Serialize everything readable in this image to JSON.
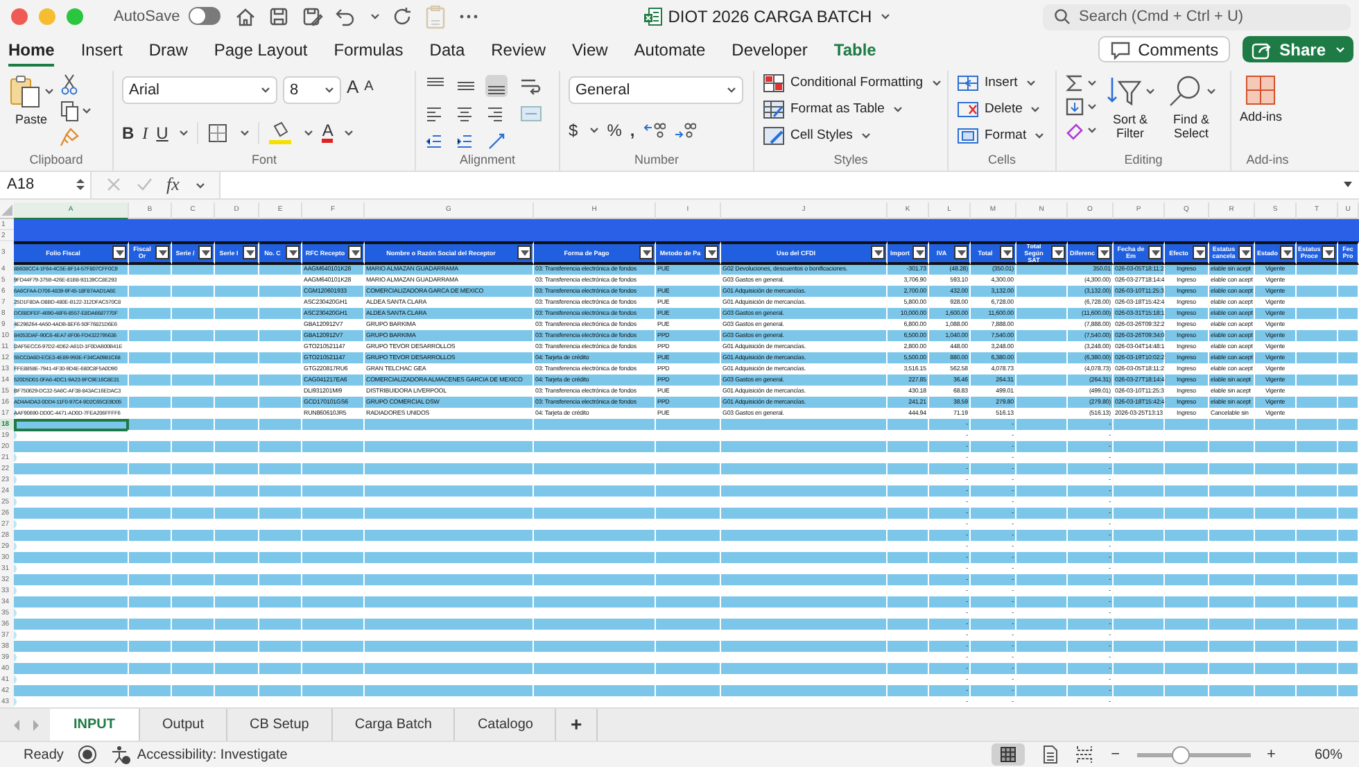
{
  "window": {
    "title": "DIOT 2026 CARGA BATCH",
    "autosave": {
      "label": "AutoSave",
      "on": false
    }
  },
  "search": {
    "placeholder": "Search (Cmd + Ctrl + U)"
  },
  "ribbon_tabs": [
    {
      "label": "Home",
      "selected": true,
      "kind": "standard"
    },
    {
      "label": "Insert",
      "selected": false,
      "kind": "standard"
    },
    {
      "label": "Draw",
      "selected": false,
      "kind": "standard"
    },
    {
      "label": "Page Layout",
      "selected": false,
      "kind": "standard"
    },
    {
      "label": "Formulas",
      "selected": false,
      "kind": "standard"
    },
    {
      "label": "Data",
      "selected": false,
      "kind": "standard"
    },
    {
      "label": "Review",
      "selected": false,
      "kind": "standard"
    },
    {
      "label": "View",
      "selected": false,
      "kind": "standard"
    },
    {
      "label": "Automate",
      "selected": false,
      "kind": "standard"
    },
    {
      "label": "Developer",
      "selected": false,
      "kind": "standard"
    },
    {
      "label": "Table",
      "selected": false,
      "kind": "contextual"
    }
  ],
  "comments_button": "Comments",
  "share_button": "Share",
  "ribbon": {
    "clipboard": {
      "label": "Clipboard",
      "paste": "Paste"
    },
    "font": {
      "label": "Font",
      "name": "Arial",
      "size": "8",
      "grow": "A",
      "shrink": "A",
      "bold": "B",
      "italic": "I",
      "underline": "U",
      "color_button": "A"
    },
    "alignment": {
      "label": "Alignment",
      "vertical": [
        {
          "selected": false
        },
        {
          "selected": false
        },
        {
          "selected": true
        }
      ]
    },
    "number": {
      "label": "Number",
      "format": "General",
      "currency": "$",
      "percent": "%",
      "comma": ","
    },
    "styles": {
      "label": "Styles",
      "items": [
        "Conditional Formatting",
        "Format as Table",
        "Cell Styles"
      ]
    },
    "cells": {
      "label": "Cells",
      "items": [
        "Insert",
        "Delete",
        "Format"
      ]
    },
    "editing": {
      "label": "Editing",
      "sort": "Sort & Filter",
      "find": "Find & Select"
    },
    "addins": {
      "label": "Add-ins",
      "button": "Add-ins"
    }
  },
  "formula_bar": {
    "cell": "A18",
    "fx": "fx"
  },
  "grid": {
    "band_rows": [
      "1",
      "2"
    ],
    "header_row": "3",
    "columns": [
      {
        "letter": "A",
        "header": "Folio Fiscal",
        "kind": "id",
        "filter": true,
        "selected": true
      },
      {
        "letter": "B",
        "header": "Fiscal Or",
        "kind": "text",
        "filter": true,
        "selected": false
      },
      {
        "letter": "C",
        "header": "Serie /",
        "kind": "text",
        "filter": true,
        "selected": false
      },
      {
        "letter": "D",
        "header": "Serie I",
        "kind": "text",
        "filter": true,
        "selected": false
      },
      {
        "letter": "E",
        "header": "No. C",
        "kind": "text",
        "filter": true,
        "selected": false
      },
      {
        "letter": "F",
        "header": "RFC Recepto",
        "kind": "text",
        "filter": true,
        "selected": false
      },
      {
        "letter": "G",
        "header": "Nombre o Razón Social del Receptor",
        "kind": "text",
        "filter": true,
        "selected": false
      },
      {
        "letter": "H",
        "header": "Forma de Pago",
        "kind": "text",
        "filter": true,
        "selected": false
      },
      {
        "letter": "I",
        "header": "Metodo de Pa",
        "kind": "text",
        "filter": true,
        "selected": false
      },
      {
        "letter": "J",
        "header": "Uso del CFDI",
        "kind": "text",
        "filter": true,
        "selected": false
      },
      {
        "letter": "K",
        "header": "Import",
        "kind": "amount",
        "filter": true,
        "selected": false
      },
      {
        "letter": "L",
        "header": "IVA",
        "kind": "amount",
        "filter": true,
        "selected": false
      },
      {
        "letter": "M",
        "header": "Total",
        "kind": "amount",
        "filter": true,
        "selected": false
      },
      {
        "letter": "N",
        "header": "Total Según SAT",
        "kind": "amount",
        "filter": true,
        "selected": false
      },
      {
        "letter": "O",
        "header": "Diferenc",
        "kind": "amount",
        "filter": true,
        "selected": false
      },
      {
        "letter": "P",
        "header": "Fecha de Em",
        "kind": "text",
        "filter": true,
        "selected": false
      },
      {
        "letter": "Q",
        "header": "Efecto",
        "kind": "center",
        "filter": true,
        "selected": false
      },
      {
        "letter": "R",
        "header": "Estatus cancela",
        "kind": "text",
        "filter": true,
        "selected": false
      },
      {
        "letter": "S",
        "header": "Estado",
        "kind": "center",
        "filter": true,
        "selected": false
      },
      {
        "letter": "T",
        "header": "Estatus Proce",
        "kind": "text",
        "filter": true,
        "selected": false
      },
      {
        "letter": "U",
        "header": "Fec Pro",
        "kind": "text",
        "filter": false,
        "selected": false
      }
    ],
    "rows": [
      {
        "number": "4",
        "selected": false,
        "cells": {
          "A": "88608CC4-1F64-4C5E-8F14-57F807CFF0C9",
          "F": "AAGM640101K28",
          "G": "MARIO ALMAZAN GUADARRAMA",
          "H": "03: Transferencia electrónica de fondos",
          "I": "PUE",
          "J": "G02 Devoluciones, descuentos o bonificaciones.",
          "K": "-301.73",
          "L": "(48.28)",
          "M": "(350.01)",
          "O": "350.01",
          "P": "026-03-05T18:11:2",
          "Q": "Ingreso",
          "R": "elable sin acept",
          "S": "Vigente"
        }
      },
      {
        "number": "5",
        "selected": false,
        "cells": {
          "A": "9FD44F79-375B-426E-81B8-93139CC8E293",
          "F": "AAGM640101K28",
          "G": "MARIO ALMAZAN GUADARRAMA",
          "H": "03: Transferencia electrónica de fondos",
          "J": "G03 Gastos en general.",
          "K": "3,706.90",
          "L": "593.10",
          "M": "4,300.00",
          "O": "(4,300.00)",
          "P": "026-03-27T18:14:4",
          "Q": "Ingreso",
          "R": "elable con acept",
          "S": "Vigente"
        }
      },
      {
        "number": "6",
        "selected": false,
        "cells": {
          "A": "6A6CFAA-D706-4839-9F45-18F87AAD1A6E",
          "F": "CGM120601933",
          "G": "COMERCIALIZADORA GARCA DE MEXICO",
          "H": "03: Transferencia electrónica de fondos",
          "I": "PUE",
          "J": "G01 Adquisición de mercancías.",
          "K": "2,700.00",
          "L": "432.00",
          "M": "3,132.00",
          "O": "(3,132.00)",
          "P": "026-03-10T11:25:3",
          "Q": "Ingreso",
          "R": "elable con acept",
          "S": "Vigente"
        }
      },
      {
        "number": "7",
        "selected": false,
        "cells": {
          "A": "25D1F8DA-D8BD-480E-B122-312DFAC570C8",
          "F": "ASC230420GH1",
          "G": "ALDEA SANTA CLARA",
          "H": "03: Transferencia electrónica de fondos",
          "I": "PUE",
          "J": "G01 Adquisición de mercancías.",
          "K": "5,800.00",
          "L": "928.00",
          "M": "6,728.00",
          "O": "(6,728.00)",
          "P": "026-03-18T15:42:4",
          "Q": "Ingreso",
          "R": "elable con acept",
          "S": "Vigente"
        }
      },
      {
        "number": "8",
        "selected": false,
        "cells": {
          "A": "DC68DFEF-4690-48F6-8557-E8DA6687770F",
          "F": "ASC230420GH1",
          "G": "ALDEA SANTA CLARA",
          "H": "03: Transferencia electrónica de fondos",
          "I": "PUE",
          "J": "G03 Gastos en general.",
          "K": "10,000.00",
          "L": "1,600.00",
          "M": "11,600.00",
          "O": "(11,600.00)",
          "P": "026-03-31T15:18:1",
          "Q": "Ingreso",
          "R": "elable con acept",
          "S": "Vigente"
        }
      },
      {
        "number": "9",
        "selected": false,
        "cells": {
          "A": "4E296264-4A50-4ADB-8EF6-50F76821D6E6",
          "F": "GBA120912V7",
          "G": "GRUPO BARKIMA",
          "H": "03: Transferencia electrónica de fondos",
          "I": "PUE",
          "J": "G03 Gastos en general.",
          "K": "6,800.00",
          "L": "1,088.00",
          "M": "7,888.00",
          "O": "(7,888.00)",
          "P": "026-03-26T09:32:2",
          "Q": "Ingreso",
          "R": "elable con acept",
          "S": "Vigente"
        }
      },
      {
        "number": "10",
        "selected": false,
        "cells": {
          "A": "84053DAF-90C6-4EA7-8F06-FD4322795636",
          "F": "GBA120912V7",
          "G": "GRUPO BARKIMA",
          "H": "03: Transferencia electrónica de fondos",
          "I": "PPD",
          "J": "G03 Gastos en general.",
          "K": "6,500.00",
          "L": "1,040.00",
          "M": "7,540.00",
          "O": "(7,540.00)",
          "P": "026-03-26T09:34:0",
          "Q": "Ingreso",
          "R": "elable con acept",
          "S": "Vigente"
        }
      },
      {
        "number": "11",
        "selected": false,
        "cells": {
          "A": "DAF5ECC6-97D2-4D62-A61D-1F0DAB00B41E",
          "F": "GTO210521147",
          "G": "GRUPO TEVOR DESARROLLOS",
          "H": "03: Transferencia electrónica de fondos",
          "I": "PPD",
          "J": "G01 Adquisición de mercancías.",
          "K": "2,800.00",
          "L": "448.00",
          "M": "3,248.00",
          "O": "(3,248.00)",
          "P": "026-03-04T14:48:1",
          "Q": "Ingreso",
          "R": "elable con acept",
          "S": "Vigente"
        }
      },
      {
        "number": "12",
        "selected": false,
        "cells": {
          "A": "55CC0A6D-ECE3-4E89-993E-F34CA0981C68",
          "F": "GTO210521147",
          "G": "GRUPO TEVOR DESARROLLOS",
          "H": "04: Tarjeta de crédito",
          "I": "PUE",
          "J": "G01 Adquisición de mercancías.",
          "K": "5,500.00",
          "L": "880.00",
          "M": "6,380.00",
          "O": "(6,380.00)",
          "P": "026-03-19T10:02:2",
          "Q": "Ingreso",
          "R": "elable con acept",
          "S": "Vigente"
        }
      },
      {
        "number": "13",
        "selected": false,
        "cells": {
          "A": "FFE8858E-7941-4F30-9D4E-680C8F5A0D90",
          "F": "GTG220817RU6",
          "G": "GRAN TELCHAC GEA",
          "H": "03: Transferencia electrónica de fondos",
          "I": "PPD",
          "J": "G01 Adquisición de mercancías.",
          "K": "3,516.15",
          "L": "562.58",
          "M": "4,078.73",
          "O": "(4,078.73)",
          "P": "026-03-05T18:11:2",
          "Q": "Ingreso",
          "R": "elable con acept",
          "S": "Vigente"
        }
      },
      {
        "number": "14",
        "selected": false,
        "cells": {
          "A": "520D5D01-0FA6-4DC1-9A23-9FC9E16C8E31",
          "F": "CAG041217EA6",
          "G": "COMERCIALIZADORA ALMACENES GARCIA DE MEXICO",
          "H": "04: Tarjeta de crédito",
          "I": "PPD",
          "J": "G03 Gastos en general.",
          "K": "227.85",
          "L": "36.46",
          "M": "264.31",
          "O": "(264.31)",
          "P": "026-03-27T18:14:4",
          "Q": "Ingreso",
          "R": "elable sin acept",
          "S": "Vigente"
        }
      },
      {
        "number": "15",
        "selected": false,
        "cells": {
          "A": "BF750629-DC32-5A6C-AF38-843AC16EDAC3",
          "F": "DLI931201MI9",
          "G": "DISTRIBUIDORA LIVERPOOL",
          "H": "03: Transferencia electrónica de fondos",
          "I": "PUE",
          "J": "G01 Adquisición de mercancías.",
          "K": "430.18",
          "L": "68.83",
          "M": "499.01",
          "O": "(499.01)",
          "P": "026-03-10T11:25:3",
          "Q": "Ingreso",
          "R": "elable sin acept",
          "S": "Vigente"
        }
      },
      {
        "number": "16",
        "selected": false,
        "cells": {
          "A": "AD4A4DA3-0DD4-11F0-97C4-9D2C65CE9D05",
          "F": "GCD170101GS6",
          "G": "GRUPO COMERCIAL DSW",
          "H": "03: Transferencia electrónica de fondos",
          "I": "PPD",
          "J": "G01 Adquisición de mercancías.",
          "K": "241.21",
          "L": "38.59",
          "M": "279.80",
          "O": "(279.80)",
          "P": "026-03-18T15:42:4",
          "Q": "Ingreso",
          "R": "elable sin acept",
          "S": "Vigente"
        }
      },
      {
        "number": "17",
        "selected": false,
        "cells": {
          "A": "AAF90690-DD0C-4471-AD0D-7FEA206FFFF6",
          "F": "RUN860610JR5",
          "G": "RADIADORES UNIDOS",
          "H": "04: Tarjeta de crédito",
          "I": "PUE",
          "J": "G03 Gastos en general.",
          "K": "444.94",
          "L": "71.19",
          "M": "516.13",
          "O": "(516.13)",
          "P": "2026-03-25T13:13",
          "Q": "Ingreso",
          "R": "Cancelable sin",
          "S": "Vigente"
        }
      },
      {
        "number": "18",
        "selected": true,
        "cells": {
          "L": "-",
          "M": "-",
          "O": "-"
        }
      },
      {
        "number": "19",
        "selected": false,
        "cells": {
          "L": "-",
          "M": "-",
          "O": "-"
        }
      },
      {
        "number": "20",
        "selected": false,
        "cells": {
          "L": "-",
          "M": "-",
          "O": "-"
        }
      },
      {
        "number": "21",
        "selected": false,
        "cells": {
          "L": "-",
          "M": "-",
          "O": "-"
        }
      },
      {
        "number": "22",
        "selected": false,
        "cells": {
          "L": "-",
          "M": "-",
          "O": "-"
        }
      },
      {
        "number": "23",
        "selected": false,
        "cells": {
          "L": "-",
          "M": "-",
          "O": "-"
        }
      },
      {
        "number": "24",
        "selected": false,
        "cells": {
          "L": "-",
          "M": "-",
          "O": "-"
        }
      },
      {
        "number": "25",
        "selected": false,
        "cells": {
          "L": "-",
          "M": "-",
          "O": "-"
        }
      },
      {
        "number": "26",
        "selected": false,
        "cells": {
          "L": "-",
          "M": "-",
          "O": "-"
        }
      },
      {
        "number": "27",
        "selected": false,
        "cells": {
          "L": "-",
          "M": "-",
          "O": "-"
        }
      },
      {
        "number": "28",
        "selected": false,
        "cells": {
          "L": "-",
          "M": "-",
          "O": "-"
        }
      },
      {
        "number": "29",
        "selected": false,
        "cells": {
          "L": "-",
          "M": "-",
          "O": "-"
        }
      },
      {
        "number": "30",
        "selected": false,
        "cells": {
          "L": "-",
          "M": "-",
          "O": "-"
        }
      },
      {
        "number": "31",
        "selected": false,
        "cells": {
          "L": "-",
          "M": "-",
          "O": "-"
        }
      },
      {
        "number": "32",
        "selected": false,
        "cells": {
          "L": "-",
          "M": "-",
          "O": "-"
        }
      },
      {
        "number": "33",
        "selected": false,
        "cells": {
          "L": "-",
          "M": "-",
          "O": "-"
        }
      },
      {
        "number": "34",
        "selected": false,
        "cells": {
          "L": "-",
          "M": "-",
          "O": "-"
        }
      },
      {
        "number": "35",
        "selected": false,
        "cells": {
          "L": "-",
          "M": "-",
          "O": "-"
        }
      },
      {
        "number": "36",
        "selected": false,
        "cells": {
          "L": "-",
          "M": "-",
          "O": "-"
        }
      },
      {
        "number": "37",
        "selected": false,
        "cells": {
          "L": "-",
          "M": "-",
          "O": "-"
        }
      },
      {
        "number": "38",
        "selected": false,
        "cells": {
          "L": "-",
          "M": "-",
          "O": "-"
        }
      },
      {
        "number": "39",
        "selected": false,
        "cells": {
          "L": "-",
          "M": "-",
          "O": "-"
        }
      },
      {
        "number": "40",
        "selected": false,
        "cells": {
          "L": "-",
          "M": "-",
          "O": "-"
        }
      },
      {
        "number": "41",
        "selected": false,
        "cells": {
          "L": "-",
          "M": "-",
          "O": "-"
        }
      },
      {
        "number": "42",
        "selected": false,
        "cells": {
          "L": "-",
          "M": "-",
          "O": "-"
        }
      },
      {
        "number": "43",
        "selected": false,
        "cells": {
          "L": "-",
          "M": "-",
          "O": "-"
        }
      }
    ]
  },
  "sheet_tabs": [
    {
      "label": "INPUT",
      "selected": true
    },
    {
      "label": "Output",
      "selected": false
    },
    {
      "label": "CB Setup",
      "selected": false
    },
    {
      "label": "Carga Batch",
      "selected": false
    },
    {
      "label": "Catalogo",
      "selected": false
    }
  ],
  "add_sheet": "+",
  "status_bar": {
    "mode": "Ready",
    "accessibility": "Accessibility: Investigate",
    "zoom": {
      "level": 0.33,
      "minus": "−",
      "plus": "+",
      "reading": "60%"
    }
  }
}
